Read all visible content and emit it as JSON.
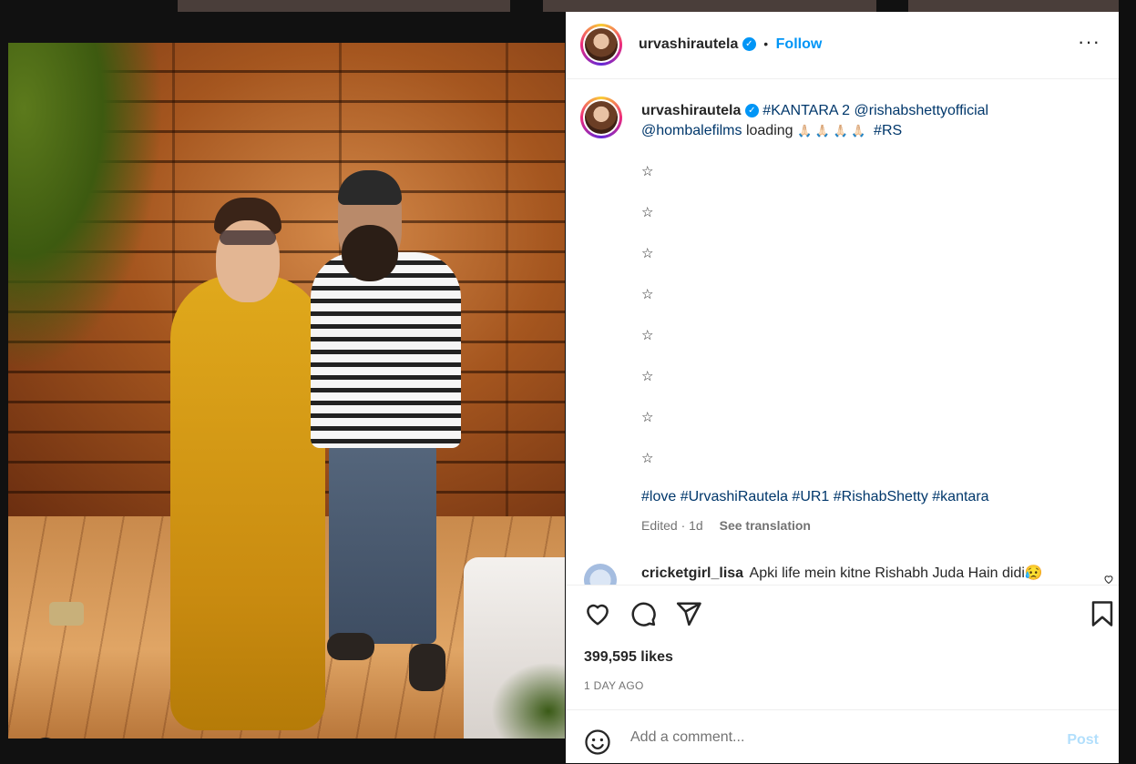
{
  "post": {
    "username": "urvashirautela",
    "verified_mark": "✓",
    "separator": "•",
    "follow_label": "Follow",
    "more_icon": "···",
    "caption": {
      "hashtag1": "#KANTARA",
      "text1": " 2 ",
      "mention1": "@rishabshettyofficial",
      "mention2": "@hombalefilms",
      "text2": " loading ",
      "emojis": "🙏🏻 🙏🏻 🙏🏻 🙏🏻",
      "hashtag2": "#RS"
    },
    "stars": [
      "☆",
      "☆",
      "☆",
      "☆",
      "☆",
      "☆",
      "☆",
      "☆"
    ],
    "hashtags_line": "#love #UrvashiRautela #UR1 #RishabShetty #kantara",
    "edited": "Edited · 1d",
    "see_translation": "See translation",
    "comment": {
      "username": "cricketgirl_lisa",
      "text": "Apki life mein kitne Rishabh Juda Hain didi😥"
    },
    "likes": "399,595 likes",
    "time_ago": "1 DAY AGO",
    "add_comment_placeholder": "Add a comment...",
    "post_label": "Post"
  },
  "colors": {
    "link": "#00376b",
    "accent": "#0095f6",
    "post_disabled": "#b2dffc",
    "muted": "#737373"
  },
  "icons": [
    "heart-icon",
    "comment-icon",
    "share-icon",
    "bookmark-icon",
    "emoji-icon",
    "user-tag-icon",
    "more-options-icon"
  ]
}
